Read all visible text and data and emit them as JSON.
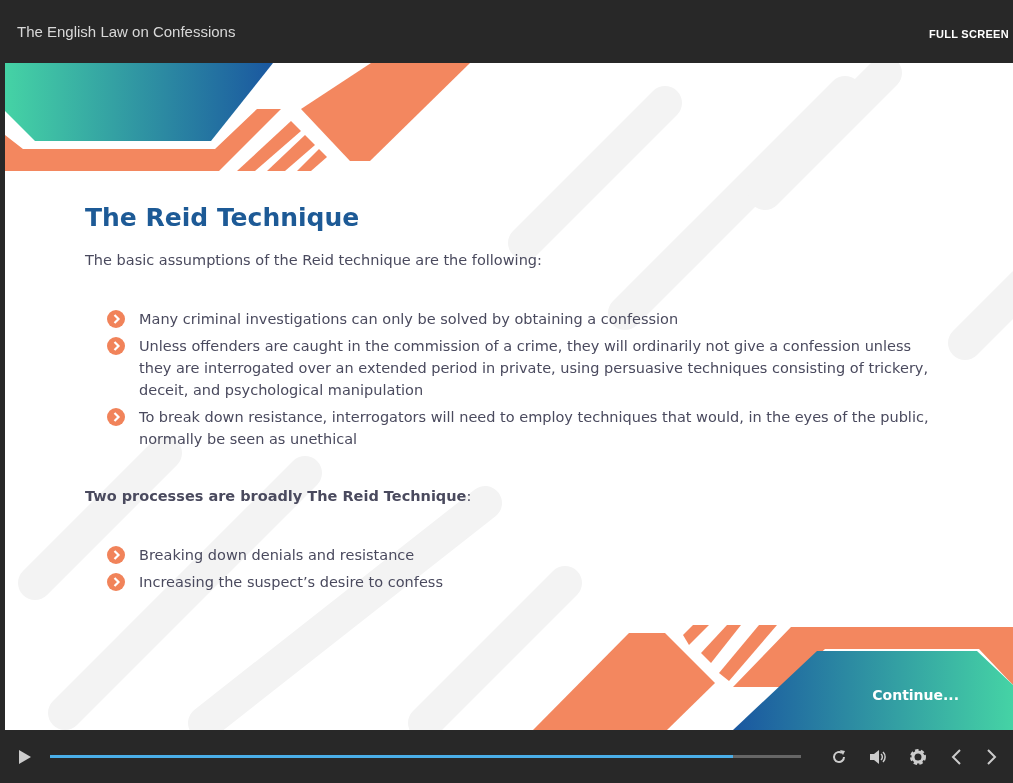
{
  "window": {
    "title": "The English Law on Confessions",
    "fullscreen_label": "FULL SCREEN"
  },
  "slide": {
    "heading": "The Reid Technique",
    "intro": "The basic assumptions of the Reid technique are the following:",
    "assumptions": [
      "Many criminal investigations can only be solved by obtaining a confession",
      "Unless offenders are caught in the commission of a crime, they will ordinarily not give a confession unless they are interrogated over an extended period in private, using persuasive techniques consisting of trickery, deceit, and psychological manipulation",
      "To break down resistance, interrogators will need to employ techniques that would, in the eyes of the public, normally be seen as unethical"
    ],
    "processes_intro": "**Two processes are broadly The Reid Technique**:",
    "processes": [
      "Breaking down denials and resistance",
      "Increasing the suspect’s desire to confess"
    ],
    "continue_label": "Continue..."
  },
  "player": {
    "progress": {
      "level": 0.91
    }
  }
}
